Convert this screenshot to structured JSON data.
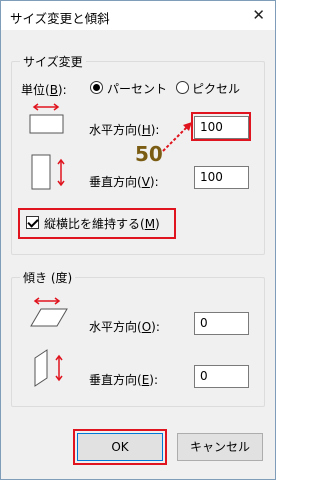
{
  "window": {
    "title": "サイズ変更と傾斜",
    "close_glyph": "✕"
  },
  "resize": {
    "legend": "サイズ変更",
    "unit_label": "単位(",
    "unit_label_key": "B",
    "unit_label_end": "):",
    "percent_label": "パーセント",
    "pixel_label": "ピクセル",
    "selected_unit": "パーセント",
    "horizontal_label": "水平方向(",
    "horizontal_key": "H",
    "horizontal_end": "):",
    "horizontal_value": "100",
    "vertical_label": "垂直方向(",
    "vertical_key": "V",
    "vertical_end": "):",
    "vertical_value": "100",
    "keep_ratio_label": "縦横比を維持する(",
    "keep_ratio_key": "M",
    "keep_ratio_end": ")",
    "keep_ratio_checked": true
  },
  "skew": {
    "legend": "傾き (度)",
    "horizontal_label": "水平方向(",
    "horizontal_key": "O",
    "horizontal_end": "):",
    "horizontal_value": "0",
    "vertical_label": "垂直方向(",
    "vertical_key": "E",
    "vertical_end": "):",
    "vertical_value": "0"
  },
  "annotation": {
    "text": "50",
    "color": "#e0141e"
  },
  "buttons": {
    "ok": "OK",
    "cancel": "キャンセル"
  },
  "colors": {
    "highlight": "#e0141e",
    "arrow": "#e0141e",
    "accent": "#0078d7"
  }
}
